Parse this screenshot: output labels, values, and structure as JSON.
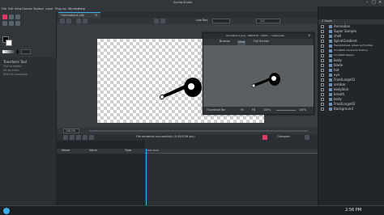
{
  "window": {
    "title": "Synfig Studio"
  },
  "menu": [
    "File",
    "Edit",
    "View",
    "Canvas",
    "Toolbox",
    "Layer",
    "Plug-Ins",
    "Window",
    "Help"
  ],
  "document_tab": {
    "label": "*Animation1.sifz"
  },
  "tool_options": {
    "title": "Transform Tool",
    "lines": [
      "Ctrl to rotate",
      "Alt to scale",
      "Shift to constrain"
    ]
  },
  "canvas": {
    "zoom": "116.2%"
  },
  "render_toolbar": {
    "left_label": "Low Res",
    "right_value": "1.0"
  },
  "preview": {
    "title": "Animation1.png - 480x270 - 100% — Gwenview",
    "buttons": [
      "Browse",
      "View",
      "Full Screen"
    ],
    "bottom_buttons": [
      "Thumbnail Bar",
      "Fit",
      "Fill",
      "100%"
    ],
    "zoom": "100%"
  },
  "params": {
    "columns": [
      "Name",
      "Value",
      "Type",
      "Time Track"
    ]
  },
  "status": {
    "message": "File rendered successfully (0.055156 sec)"
  },
  "keyframe_mode": {
    "label": "Clamped"
  },
  "layers": {
    "header": "Z Depth",
    "items": [
      "Animation",
      "Super Sample",
      "shell",
      "SpiralGradient",
      "Headphones1 Advanced Outline",
      "Circle009 Advanced Outline",
      "Circle009 Region",
      "body",
      "blade",
      "hat",
      "eye",
      "FrontLarge01",
      "armbar",
      "bodySkin",
      "breath",
      "body",
      "FrontLarge02",
      "Background"
    ]
  },
  "taskbar": {
    "time": "2:56 PM"
  },
  "colors": {
    "accent": "#e03a63",
    "panel": "#31363b",
    "select": "#3daee9"
  }
}
